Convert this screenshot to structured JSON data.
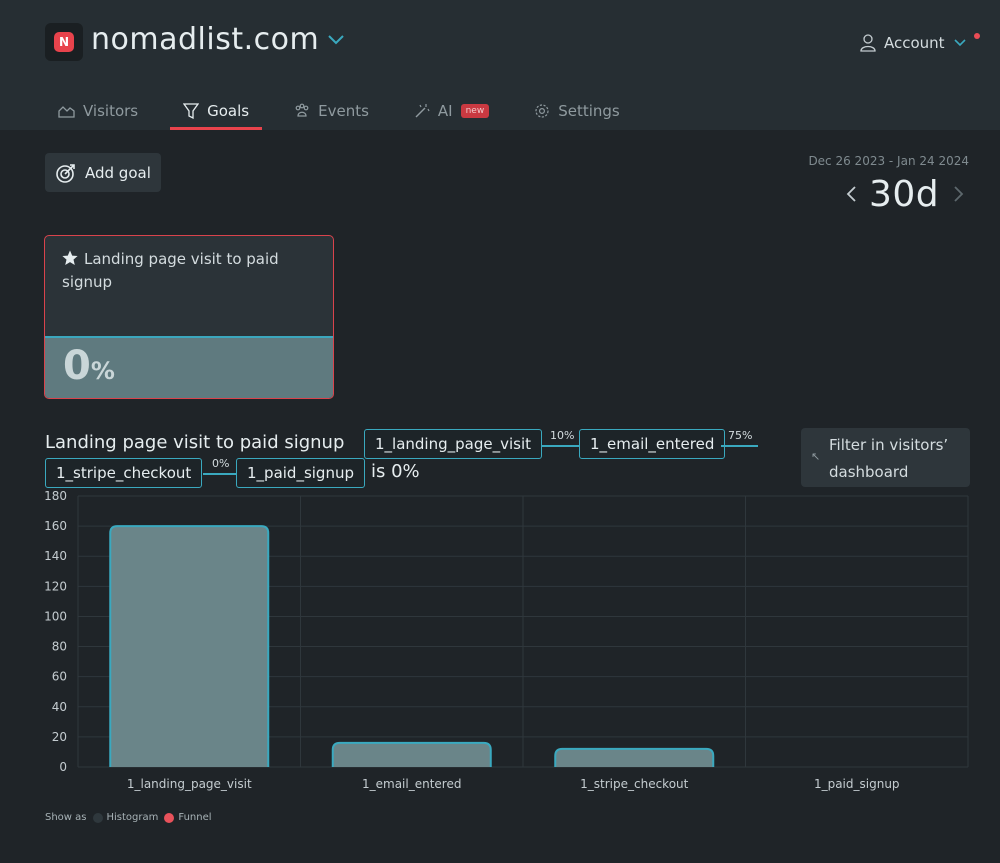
{
  "header": {
    "site_name": "nomadlist.com",
    "logo_glyph": "N",
    "account_label": "Account"
  },
  "tabs": [
    {
      "label": "Visitors",
      "icon": "chart-area-icon",
      "active": false
    },
    {
      "label": "Goals",
      "icon": "funnel-icon",
      "active": true
    },
    {
      "label": "Events",
      "icon": "paw-icon",
      "active": false
    },
    {
      "label": "AI",
      "icon": "magic-wand-icon",
      "active": false,
      "badge": "new"
    },
    {
      "label": "Settings",
      "icon": "gear-icon",
      "active": false
    }
  ],
  "toolbar": {
    "add_goal_label": "Add goal",
    "date_range": "Dec 26 2023 - Jan 24 2024",
    "period": "30d"
  },
  "goal_card": {
    "title": "Landing page visit to paid signup",
    "value": "0",
    "unit": "%",
    "fill_fraction": 0.0,
    "icon": "star-icon"
  },
  "funnel": {
    "title": "Landing page visit to paid signup",
    "steps": [
      {
        "label": "1_landing_page_visit"
      },
      {
        "label": "1_email_entered"
      },
      {
        "label": "1_stripe_checkout"
      },
      {
        "label": "1_paid_signup"
      }
    ],
    "conversions": [
      "10%",
      "75%",
      "0%"
    ],
    "result": "is 0%",
    "filter_label": "Filter in visitors’ dashboard",
    "filter_icon": "arrow-up-left-icon"
  },
  "legend": {
    "show_as": "Show as",
    "options": [
      {
        "label": "Histogram",
        "color": "#2f383d",
        "selected": false
      },
      {
        "label": "Funnel",
        "color": "#e8525b",
        "selected": true
      }
    ]
  },
  "colors": {
    "accent_red": "#e8434c",
    "accent_teal": "#3aa9bf",
    "bar_fill": "#6a8589",
    "background": "#1f2428"
  },
  "chart_data": {
    "type": "bar",
    "categories": [
      "1_landing_page_visit",
      "1_email_entered",
      "1_stripe_checkout",
      "1_paid_signup"
    ],
    "values": [
      160,
      16,
      12,
      0
    ],
    "ylim": [
      0,
      180
    ],
    "yticks": [
      0,
      20,
      40,
      60,
      80,
      100,
      120,
      140,
      160,
      180
    ],
    "grid": true,
    "xlabel": "",
    "ylabel": "",
    "title": ""
  }
}
